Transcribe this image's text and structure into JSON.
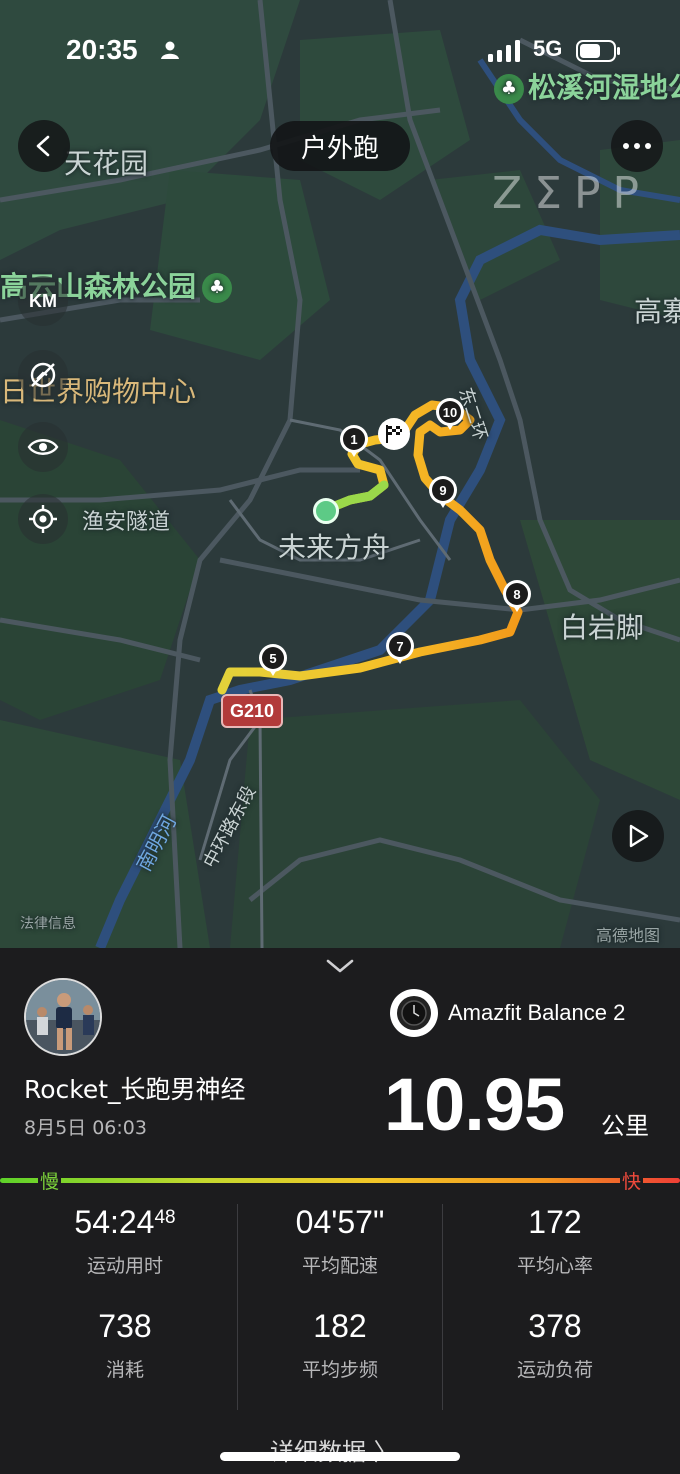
{
  "status_bar": {
    "time": "20:35",
    "network": "5G"
  },
  "map": {
    "title": "户外跑",
    "watermark": "ZΣPP",
    "unit_toggle": "KM",
    "labels": {
      "songxi": "松溪河湿地公",
      "tianhua": "天花园",
      "gaoyun": "高云山森林公园",
      "gao": "高寨",
      "shopping": "日世界购物中心",
      "dongerhuan": "东二环",
      "yuan_tunnel": "渔安隧道",
      "weilai": "未来方舟",
      "baiyanjiao": "白岩脚",
      "g210": "G210",
      "zhonghuan": "中环路东段",
      "nanming": "南明河",
      "legal": "法律信息",
      "gaode": "高德地图"
    },
    "markers": [
      "1",
      "5",
      "7",
      "8",
      "9",
      "10"
    ],
    "route_color_slow": "#7bd23a",
    "route_color_fast": "#f29a1a"
  },
  "panel": {
    "device_name": "Amazfit Balance 2",
    "user_name": "Rocket_长跑男神经",
    "date": "8月5日 06:03",
    "distance": "10.95",
    "distance_unit": "公里",
    "slow_label": "慢",
    "fast_label": "快",
    "stats": {
      "duration": {
        "value": "54:24",
        "sub": "48",
        "label": "运动用时"
      },
      "pace": {
        "value": "04'57\"",
        "label": "平均配速"
      },
      "heart_rate": {
        "value": "172",
        "label": "平均心率"
      },
      "calories": {
        "value": "738",
        "label": "消耗"
      },
      "cadence": {
        "value": "182",
        "label": "平均步频"
      },
      "load": {
        "value": "378",
        "label": "运动负荷"
      }
    },
    "detail_link": "详细数据 〉"
  }
}
